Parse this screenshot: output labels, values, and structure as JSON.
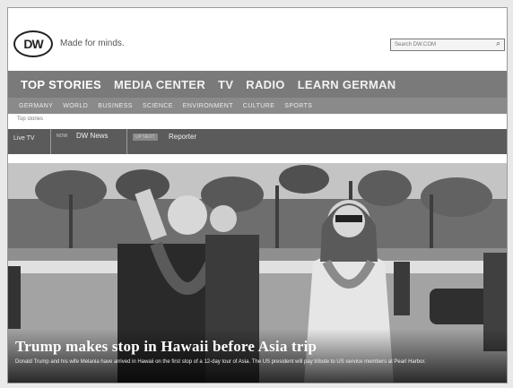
{
  "header": {
    "logo_text": "DW",
    "tagline": "Made for minds.",
    "search_placeholder": "Search DW.COM"
  },
  "nav_main": {
    "items": [
      {
        "label": "TOP STORIES",
        "active": true
      },
      {
        "label": "MEDIA CENTER",
        "active": false
      },
      {
        "label": "TV",
        "active": false
      },
      {
        "label": "RADIO",
        "active": false
      },
      {
        "label": "LEARN GERMAN",
        "active": false
      }
    ]
  },
  "nav_sub": {
    "items": [
      {
        "label": "GERMANY"
      },
      {
        "label": "WORLD"
      },
      {
        "label": "BUSINESS"
      },
      {
        "label": "SCIENCE"
      },
      {
        "label": "ENVIRONMENT"
      },
      {
        "label": "CULTURE"
      },
      {
        "label": "SPORTS"
      }
    ]
  },
  "breadcrumb": "Top stories",
  "live_bar": {
    "tv_label": "Live TV",
    "news_tag": "NOW",
    "news_title": "DW News",
    "reporter_tag": "UP NEXT",
    "reporter_title": "Reporter"
  },
  "hero": {
    "headline": "Trump makes stop in Hawaii before Asia trip",
    "teaser": "Donald Trump and his wife Melania have arrived in Hawaii on the first stop of a 12-day tour of Asia. The US president will pay tribute to US service members at Pearl Harbor."
  },
  "colors": {
    "nav_main_bg": "#7a7a7a",
    "nav_sub_bg": "#8a8a8a",
    "live_bar_bg": "#5b5b5b"
  }
}
